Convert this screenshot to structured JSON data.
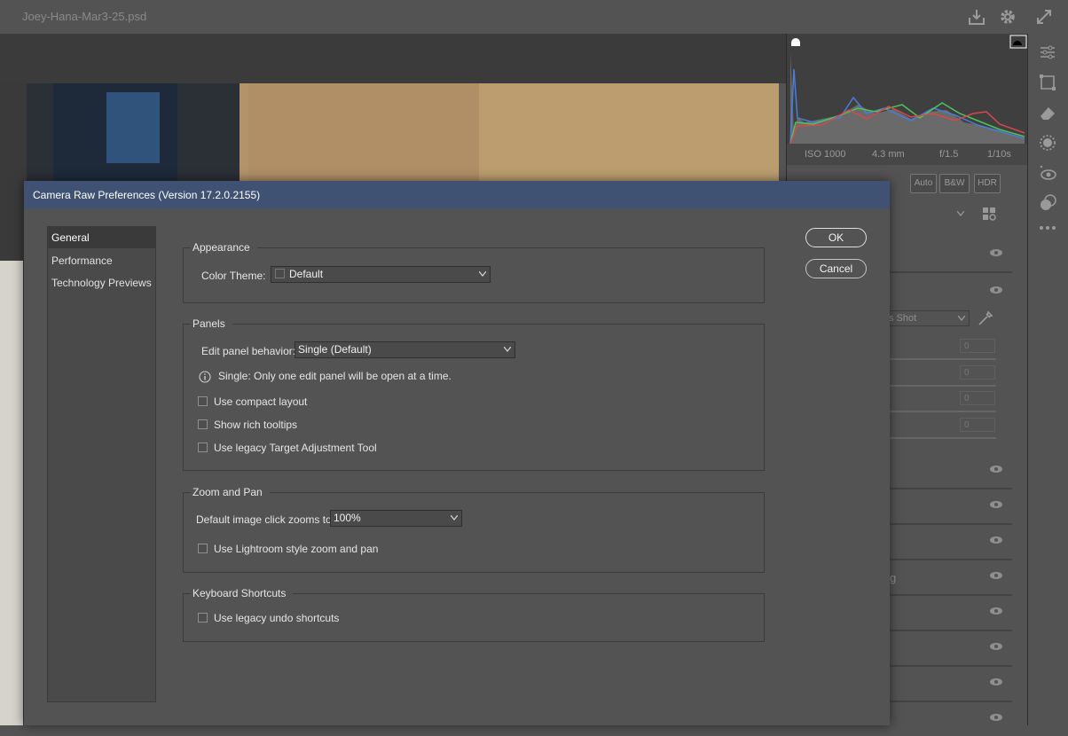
{
  "app": {
    "document_title": "Joey-Hana-Mar3-25.psd",
    "icons": [
      "save-download-icon",
      "gear-icon",
      "expand-icon"
    ]
  },
  "histogram": {
    "camera_info": {
      "iso": "ISO 1000",
      "focal_length": "4.3 mm",
      "aperture": "f/1.5",
      "shutter": "1/10s"
    }
  },
  "right_panel": {
    "buttons": [
      "Auto",
      "B&W",
      "HDR"
    ],
    "profile_partial": "s Shot",
    "row_partial_g": "g",
    "field_values": [
      "0",
      "0",
      "0",
      "0"
    ]
  },
  "dialog": {
    "title": "Camera Raw Preferences  (Version 17.2.0.2155)",
    "nav": [
      "General",
      "Performance",
      "Technology Previews"
    ],
    "nav_selected": "General",
    "ok_label": "OK",
    "cancel_label": "Cancel",
    "appearance": {
      "title": "Appearance",
      "color_theme_label": "Color Theme:",
      "color_theme_value": "Default"
    },
    "panels": {
      "title": "Panels",
      "edit_behavior_label": "Edit panel behavior:",
      "edit_behavior_value": "Single (Default)",
      "info_text": "Single: Only one edit panel will be open at a time.",
      "checkboxes": [
        {
          "label": "Use compact layout",
          "checked": false
        },
        {
          "label": "Show rich tooltips",
          "checked": false
        },
        {
          "label": "Use legacy Target Adjustment Tool",
          "checked": false
        }
      ]
    },
    "zoom": {
      "title": "Zoom and Pan",
      "default_zoom_label": "Default image click zooms to:",
      "default_zoom_value": "100%",
      "checkboxes": [
        {
          "label": "Use Lightroom style zoom and pan",
          "checked": false
        }
      ]
    },
    "keyboard": {
      "title": "Keyboard Shortcuts",
      "checkboxes": [
        {
          "label": "Use legacy undo shortcuts",
          "checked": false
        }
      ]
    }
  },
  "colors": {
    "dialog_title_bar": "#3f5273",
    "dialog_background": "#535353",
    "nav_selected": "#3a3a3a"
  }
}
